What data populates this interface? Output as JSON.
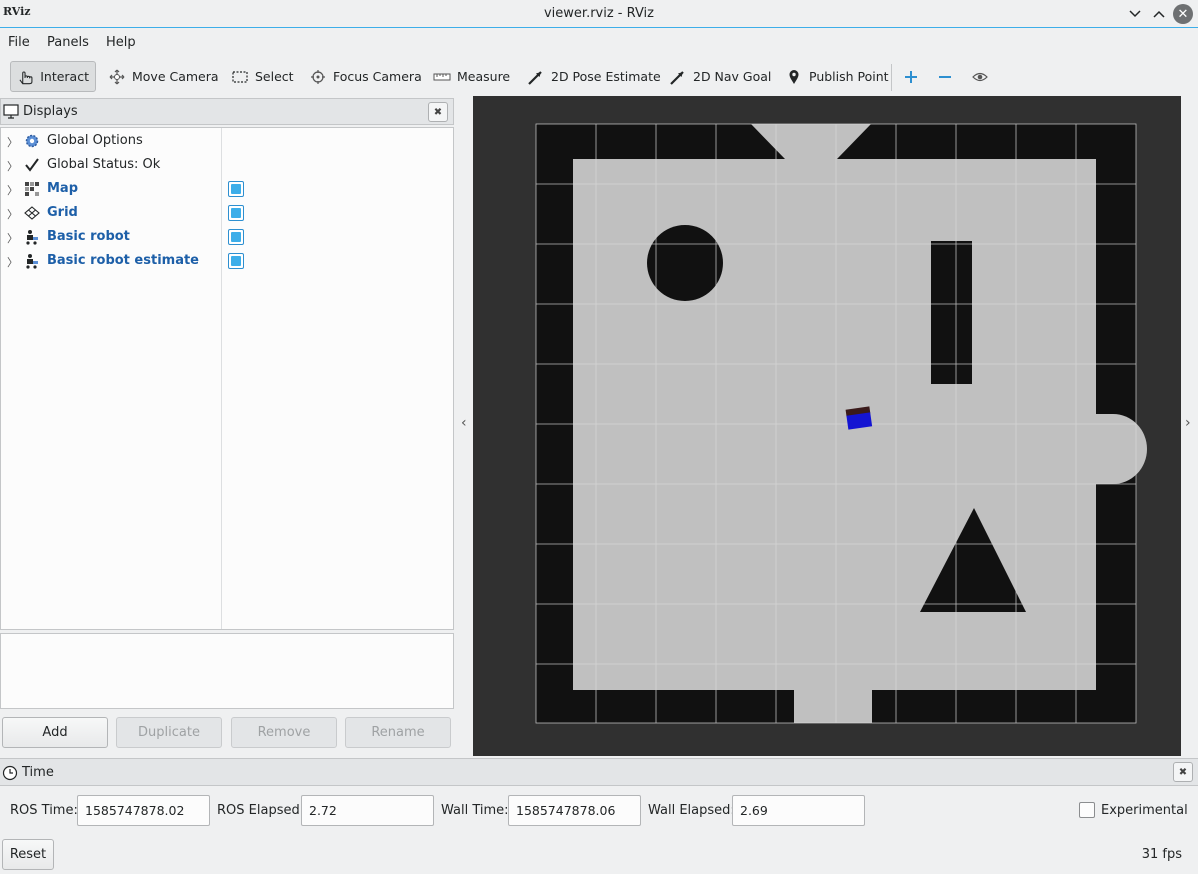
{
  "window": {
    "title": "viewer.rviz - RViz",
    "logo": "RViz"
  },
  "menu": [
    "File",
    "Panels",
    "Help"
  ],
  "toolbar": {
    "tools": [
      {
        "label": "Interact",
        "icon": "hand-pointer-icon",
        "active": true
      },
      {
        "label": "Move Camera",
        "icon": "move-camera-icon"
      },
      {
        "label": "Select",
        "icon": "select-rectangle-icon"
      },
      {
        "label": "Focus Camera",
        "icon": "focus-camera-icon"
      },
      {
        "label": "Measure",
        "icon": "ruler-icon"
      },
      {
        "label": "2D Pose Estimate",
        "icon": "green-arrow-icon"
      },
      {
        "label": "2D Nav Goal",
        "icon": "pink-arrow-icon"
      },
      {
        "label": "Publish Point",
        "icon": "map-pin-icon"
      }
    ],
    "extra_icons": [
      "plus-icon",
      "minus-icon",
      "eye-icon"
    ]
  },
  "displays": {
    "title": "Displays",
    "items": [
      {
        "label": "Global Options",
        "icon": "gear-icon",
        "checkbox": false,
        "highlight": false
      },
      {
        "label": "Global Status: Ok",
        "icon": "checkmark-icon",
        "checkbox": false,
        "highlight": false
      },
      {
        "label": "Map",
        "icon": "map-icon",
        "checkbox": true,
        "highlight": true
      },
      {
        "label": "Grid",
        "icon": "grid-icon",
        "checkbox": true,
        "highlight": true
      },
      {
        "label": "Basic robot",
        "icon": "robot-icon",
        "checkbox": true,
        "highlight": true
      },
      {
        "label": "Basic robot estimate",
        "icon": "robot-icon",
        "checkbox": true,
        "highlight": true
      }
    ],
    "buttons": {
      "add": "Add",
      "duplicate": "Duplicate",
      "remove": "Remove",
      "rename": "Rename"
    }
  },
  "time": {
    "title": "Time",
    "ros_time_label": "ROS Time:",
    "ros_time": "1585747878.02",
    "ros_elapsed_label": "ROS Elapsed:",
    "ros_elapsed": "2.72",
    "wall_time_label": "Wall Time:",
    "wall_time": "1585747878.06",
    "wall_elapsed_label": "Wall Elapsed:",
    "wall_elapsed": "2.69",
    "experimental_label": "Experimental",
    "experimental_checked": false
  },
  "status": {
    "reset": "Reset",
    "fps": "31 fps"
  },
  "colors": {
    "accent": "#3daee9",
    "map_free": "#c0c0c0",
    "map_occupied": "#111111",
    "robot": "#1414d2",
    "highlight_text": "#1d5fa8"
  }
}
